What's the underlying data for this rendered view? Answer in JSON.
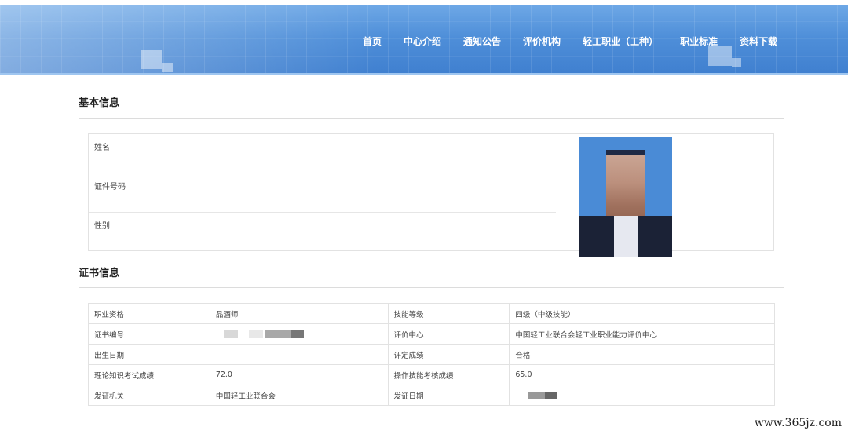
{
  "nav": [
    "首页",
    "中心介绍",
    "通知公告",
    "评价机构",
    "轻工职业（工种）",
    "职业标准",
    "资料下载"
  ],
  "basic": {
    "title": "基本信息",
    "fields": [
      "姓名",
      "证件号码",
      "性别"
    ]
  },
  "cert": {
    "title": "证书信息",
    "rows": [
      {
        "l1": "职业资格",
        "v1": "品酒师",
        "l2": "技能等级",
        "v2": "四级（中级技能）"
      },
      {
        "l1": "证书编号",
        "v1": "",
        "l2": "评价中心",
        "v2": "中国轻工业联合会轻工业职业能力评价中心"
      },
      {
        "l1": "出生日期",
        "v1": "",
        "l2": "评定成绩",
        "v2": "合格"
      },
      {
        "l1": "理论知识考试成绩",
        "v1": "72.0",
        "l2": "操作技能考核成绩",
        "v2": "65.0"
      },
      {
        "l1": "发证机关",
        "v1": "中国轻工业联合会",
        "l2": "发证日期",
        "v2": ""
      }
    ]
  },
  "watermark": "www.365jz.com"
}
